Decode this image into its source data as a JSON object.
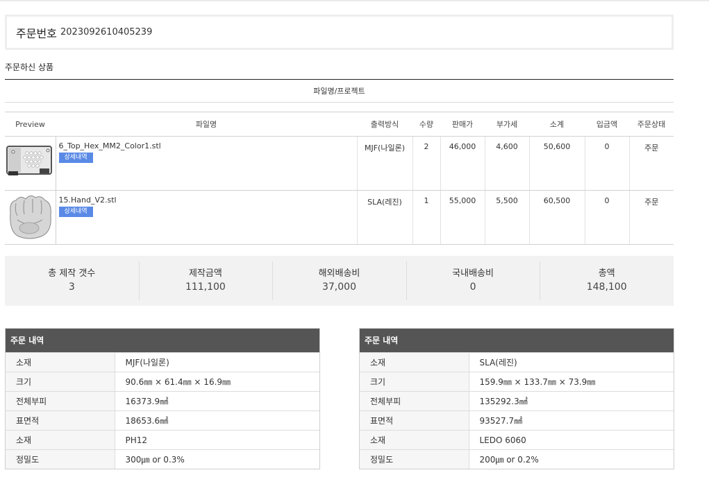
{
  "order": {
    "label": "주문번호",
    "number": "2023092610405239"
  },
  "products_section": {
    "title": "주문하신 상품",
    "project_label": "파일명/프로젝트"
  },
  "items_table": {
    "headers": [
      "Preview",
      "파일명",
      "출력방식",
      "수량",
      "판매가",
      "부가세",
      "소계",
      "입금액",
      "주문상태"
    ],
    "detail_button_label": "상세내역",
    "rows": [
      {
        "preview_icon": "hex-plate-3d-preview",
        "filename": "6_Top_Hex_MM2_Color1.stl",
        "method": "MJF(나일론)",
        "qty": "2",
        "price": "46,000",
        "vat": "4,600",
        "subtotal": "50,600",
        "paid": "0",
        "status": "주문"
      },
      {
        "preview_icon": "hand-3d-preview",
        "filename": "15.Hand_V2.stl",
        "method": "SLA(레진)",
        "qty": "1",
        "price": "55,000",
        "vat": "5,500",
        "subtotal": "60,500",
        "paid": "0",
        "status": "주문"
      }
    ]
  },
  "summary": [
    {
      "label": "총 제작 갯수",
      "value": "3"
    },
    {
      "label": "제작금액",
      "value": "111,100"
    },
    {
      "label": "해외배송비",
      "value": "37,000"
    },
    {
      "label": "국내배송비",
      "value": "0"
    },
    {
      "label": "총액",
      "value": "148,100"
    }
  ],
  "order_details": [
    {
      "title": "주문 내역",
      "rows": [
        {
          "key": "소재",
          "value": "MJF(나일론)"
        },
        {
          "key": "크기",
          "value": "90.6㎜ × 61.4㎜ × 16.9㎜"
        },
        {
          "key": "전체부피",
          "value": "16373.9㎣"
        },
        {
          "key": "표면적",
          "value": "18653.6㎟"
        },
        {
          "key": "소재",
          "value": "PH12"
        },
        {
          "key": "정밀도",
          "value": "300㎛ or 0.3%"
        }
      ]
    },
    {
      "title": "주문 내역",
      "rows": [
        {
          "key": "소재",
          "value": "SLA(레진)"
        },
        {
          "key": "크기",
          "value": "159.9㎜ × 133.7㎜ × 73.9㎜"
        },
        {
          "key": "전체부피",
          "value": "135292.3㎣"
        },
        {
          "key": "표면적",
          "value": "93527.7㎟"
        },
        {
          "key": "소재",
          "value": "LEDO 6060"
        },
        {
          "key": "정밀도",
          "value": "200㎛ or 0.2%"
        }
      ]
    }
  ],
  "colors": {
    "detail_button": "#5a8ae6",
    "detail_header": "#555555",
    "summary_bg": "#f2f2f2"
  }
}
